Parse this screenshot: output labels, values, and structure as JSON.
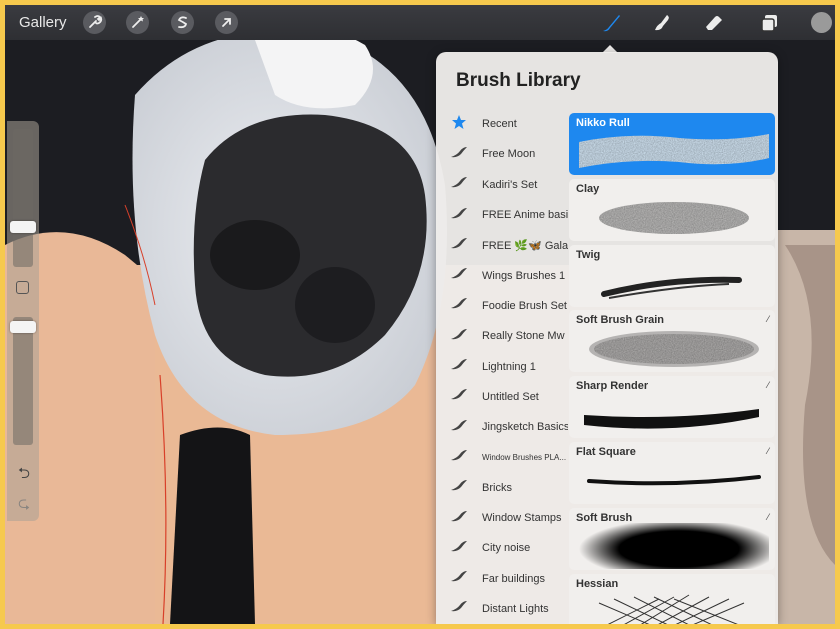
{
  "topbar": {
    "gallery_label": "Gallery",
    "tools": [
      "wrench-icon",
      "magic-wand-icon",
      "selection-icon",
      "transform-icon"
    ],
    "right_tools": [
      "brush-icon",
      "smudge-icon",
      "eraser-icon",
      "layers-icon",
      "color-icon"
    ],
    "accent": "#1e88ef"
  },
  "panel": {
    "title": "Brush Library",
    "sets": [
      {
        "label": "Recent",
        "icon": "star-icon"
      },
      {
        "label": "Free Moon",
        "icon": "brush-stroke-icon"
      },
      {
        "label": "Kadiri's Set",
        "icon": "brush-stroke-icon"
      },
      {
        "label": "FREE Anime basic",
        "icon": "brush-stroke-icon"
      },
      {
        "label": "FREE 🌿🦋 Galactic",
        "icon": "brush-stroke-icon"
      },
      {
        "label": "Wings Brushes 1",
        "icon": "brush-stroke-icon"
      },
      {
        "label": "Foodie Brush Set",
        "icon": "brush-stroke-icon"
      },
      {
        "label": "Really Stone Mw",
        "icon": "brush-stroke-icon"
      },
      {
        "label": "Lightning 1",
        "icon": "brush-stroke-icon"
      },
      {
        "label": "Untitled Set",
        "icon": "brush-stroke-icon"
      },
      {
        "label": "Jingsketch Basics",
        "icon": "brush-stroke-icon"
      },
      {
        "label": "Window Brushes PLA...",
        "icon": "brush-stroke-icon"
      },
      {
        "label": "Bricks",
        "icon": "brush-stroke-icon"
      },
      {
        "label": "Window Stamps",
        "icon": "brush-stroke-icon"
      },
      {
        "label": "City noise",
        "icon": "brush-stroke-icon"
      },
      {
        "label": "Far buildings",
        "icon": "brush-stroke-icon"
      },
      {
        "label": "Distant Lights",
        "icon": "brush-stroke-icon"
      }
    ],
    "brushes": [
      {
        "name": "Nikko Rull",
        "selected": true
      },
      {
        "name": "Clay",
        "selected": false
      },
      {
        "name": "Twig",
        "selected": false
      },
      {
        "name": "Soft Brush Grain",
        "selected": false
      },
      {
        "name": "Sharp Render",
        "selected": false
      },
      {
        "name": "Flat Square",
        "selected": false
      },
      {
        "name": "Soft Brush",
        "selected": false
      },
      {
        "name": "Hessian",
        "selected": false
      }
    ]
  }
}
